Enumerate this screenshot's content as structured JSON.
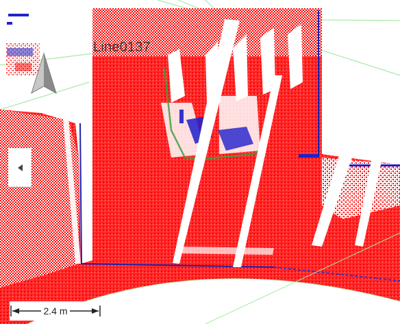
{
  "viewer": {
    "line_label": "Line0137",
    "scale_bar_label": "2.4 m"
  },
  "icons": {
    "compass": "north-arrow-icon",
    "collapse_handle": "chevron-left-icon"
  },
  "colors": {
    "point_cloud_primary": "#ff0000",
    "point_cloud_secondary": "#1f1fcc",
    "alignment_lines": "#9fe89f",
    "ui_background": "#ffffff"
  }
}
